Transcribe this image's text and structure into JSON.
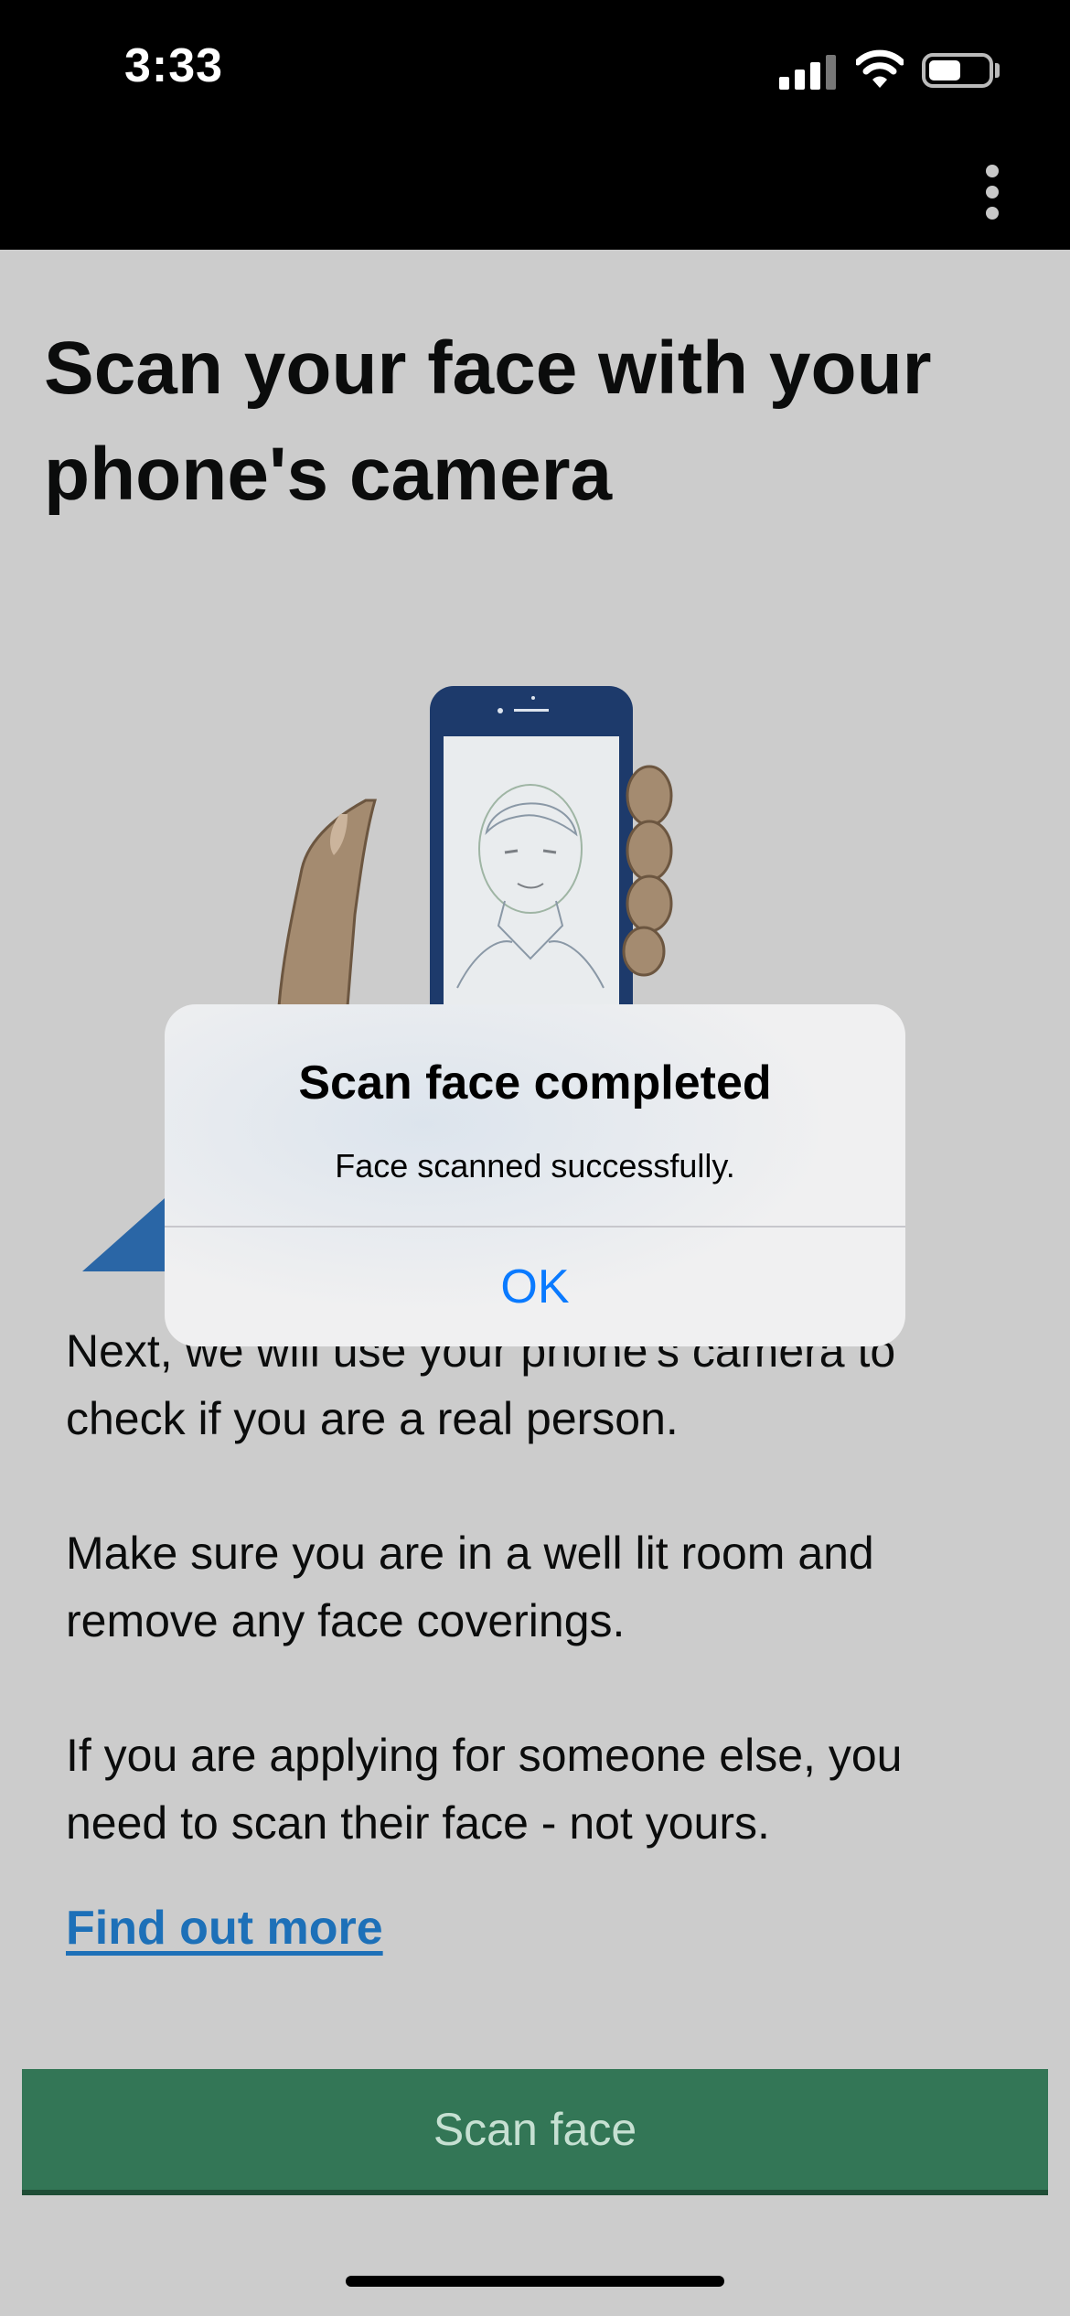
{
  "status_bar": {
    "time": "3:33"
  },
  "page": {
    "title": "Scan your face with your phone's camera",
    "paragraphs": [
      "Next, we will use your phone's camera to check if you are a real person.",
      "Make sure you are in a well lit room and remove any face coverings.",
      "If you are applying for someone else, you need to scan their face - not yours."
    ],
    "link_text": "Find out more",
    "button_label": "Scan face"
  },
  "dialog": {
    "title": "Scan face completed",
    "message": "Face scanned successfully.",
    "ok_label": "OK"
  },
  "colors": {
    "background": "#cccccc",
    "button": "#337656",
    "link": "#1d70b8",
    "dialog_action": "#0a7aff",
    "phone": "#1d3a6b"
  },
  "icons": [
    "cellular-signal-icon",
    "wifi-icon",
    "battery-icon",
    "more-options-icon"
  ]
}
